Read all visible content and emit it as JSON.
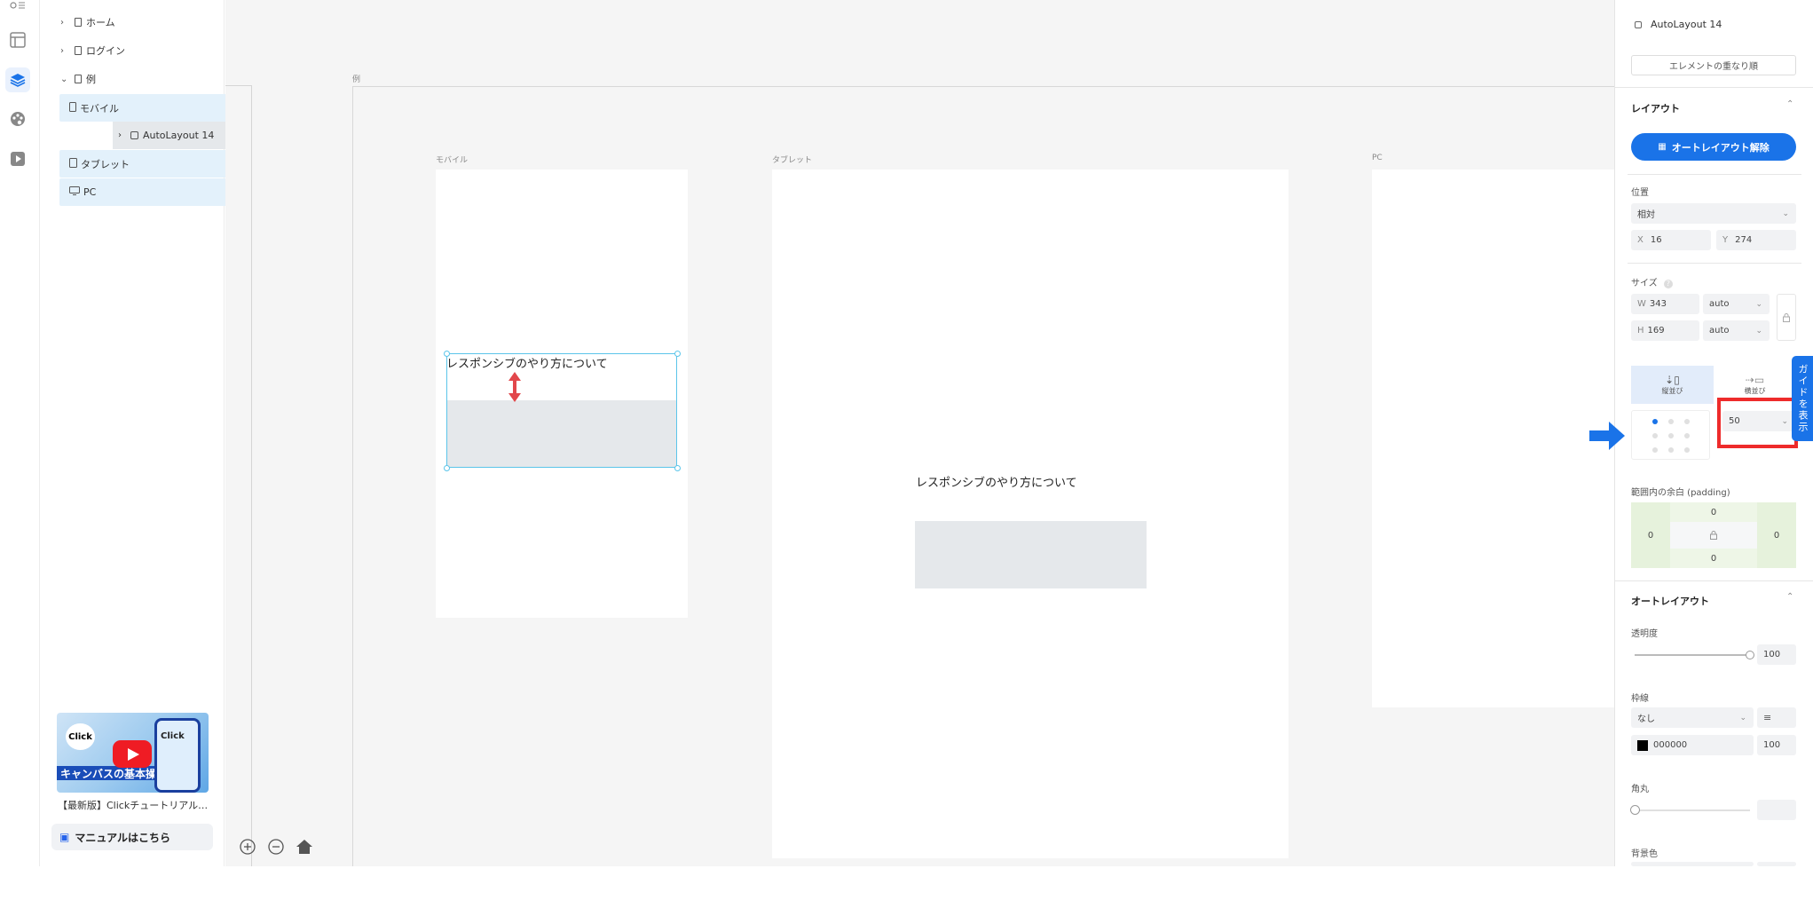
{
  "sidebar": {
    "pages": [
      {
        "label": "ホーム",
        "expanded": false
      },
      {
        "label": "ログイン",
        "expanded": false
      },
      {
        "label": "例",
        "expanded": true
      }
    ],
    "devices": [
      {
        "label": "モバイル",
        "toggle": "-"
      },
      {
        "label": "タブレット",
        "toggle": "+"
      },
      {
        "label": "PC",
        "toggle": "+"
      }
    ],
    "child_label": "AutoLayout 14",
    "video": {
      "badge": "Click",
      "band_text": "キャンバスの基本操作",
      "phone_text": "Click",
      "title": "【最新版】Clickチュートリアル…"
    },
    "manual_label": "マニュアルはこちら"
  },
  "canvas": {
    "frame_label": "例",
    "screens": {
      "mobile": "モバイル",
      "tablet": "タブレット",
      "pc": "PC"
    },
    "heading_text": "レスポンシブのやり方について"
  },
  "props": {
    "selected": "AutoLayout 14",
    "order_button": "エレメントの重なり順",
    "layout_title": "レイアウト",
    "unlock_button": "オートレイアウト解除",
    "position_label": "位置",
    "position_value": "相対",
    "x_label": "X",
    "x_value": "16",
    "y_label": "Y",
    "y_value": "274",
    "size_label": "サイズ",
    "w_label": "W",
    "w_value": "343",
    "w_mode": "auto",
    "h_label": "H",
    "h_value": "169",
    "h_mode": "auto",
    "vertical_label": "縦並び",
    "horizontal_label": "横並び",
    "gap_value": "50",
    "padding_label": "範囲内の余白 (padding)",
    "padding": {
      "top": "0",
      "left": "0",
      "right": "0",
      "bottom": "0"
    },
    "autolayout_title": "オートレイアウト",
    "opacity_label": "透明度",
    "opacity_value": "100",
    "border_label": "枠線",
    "border_style": "なし",
    "border_color": "000000",
    "border_opacity": "100",
    "radius_label": "角丸",
    "bg_label": "背景色"
  },
  "guide_tab": "ガイドを表示",
  "colors": {
    "accent": "#1a73e8",
    "selection": "#5bc5ea",
    "highlight": "#ee2b2b",
    "resize_arrow": "#e2474b"
  }
}
